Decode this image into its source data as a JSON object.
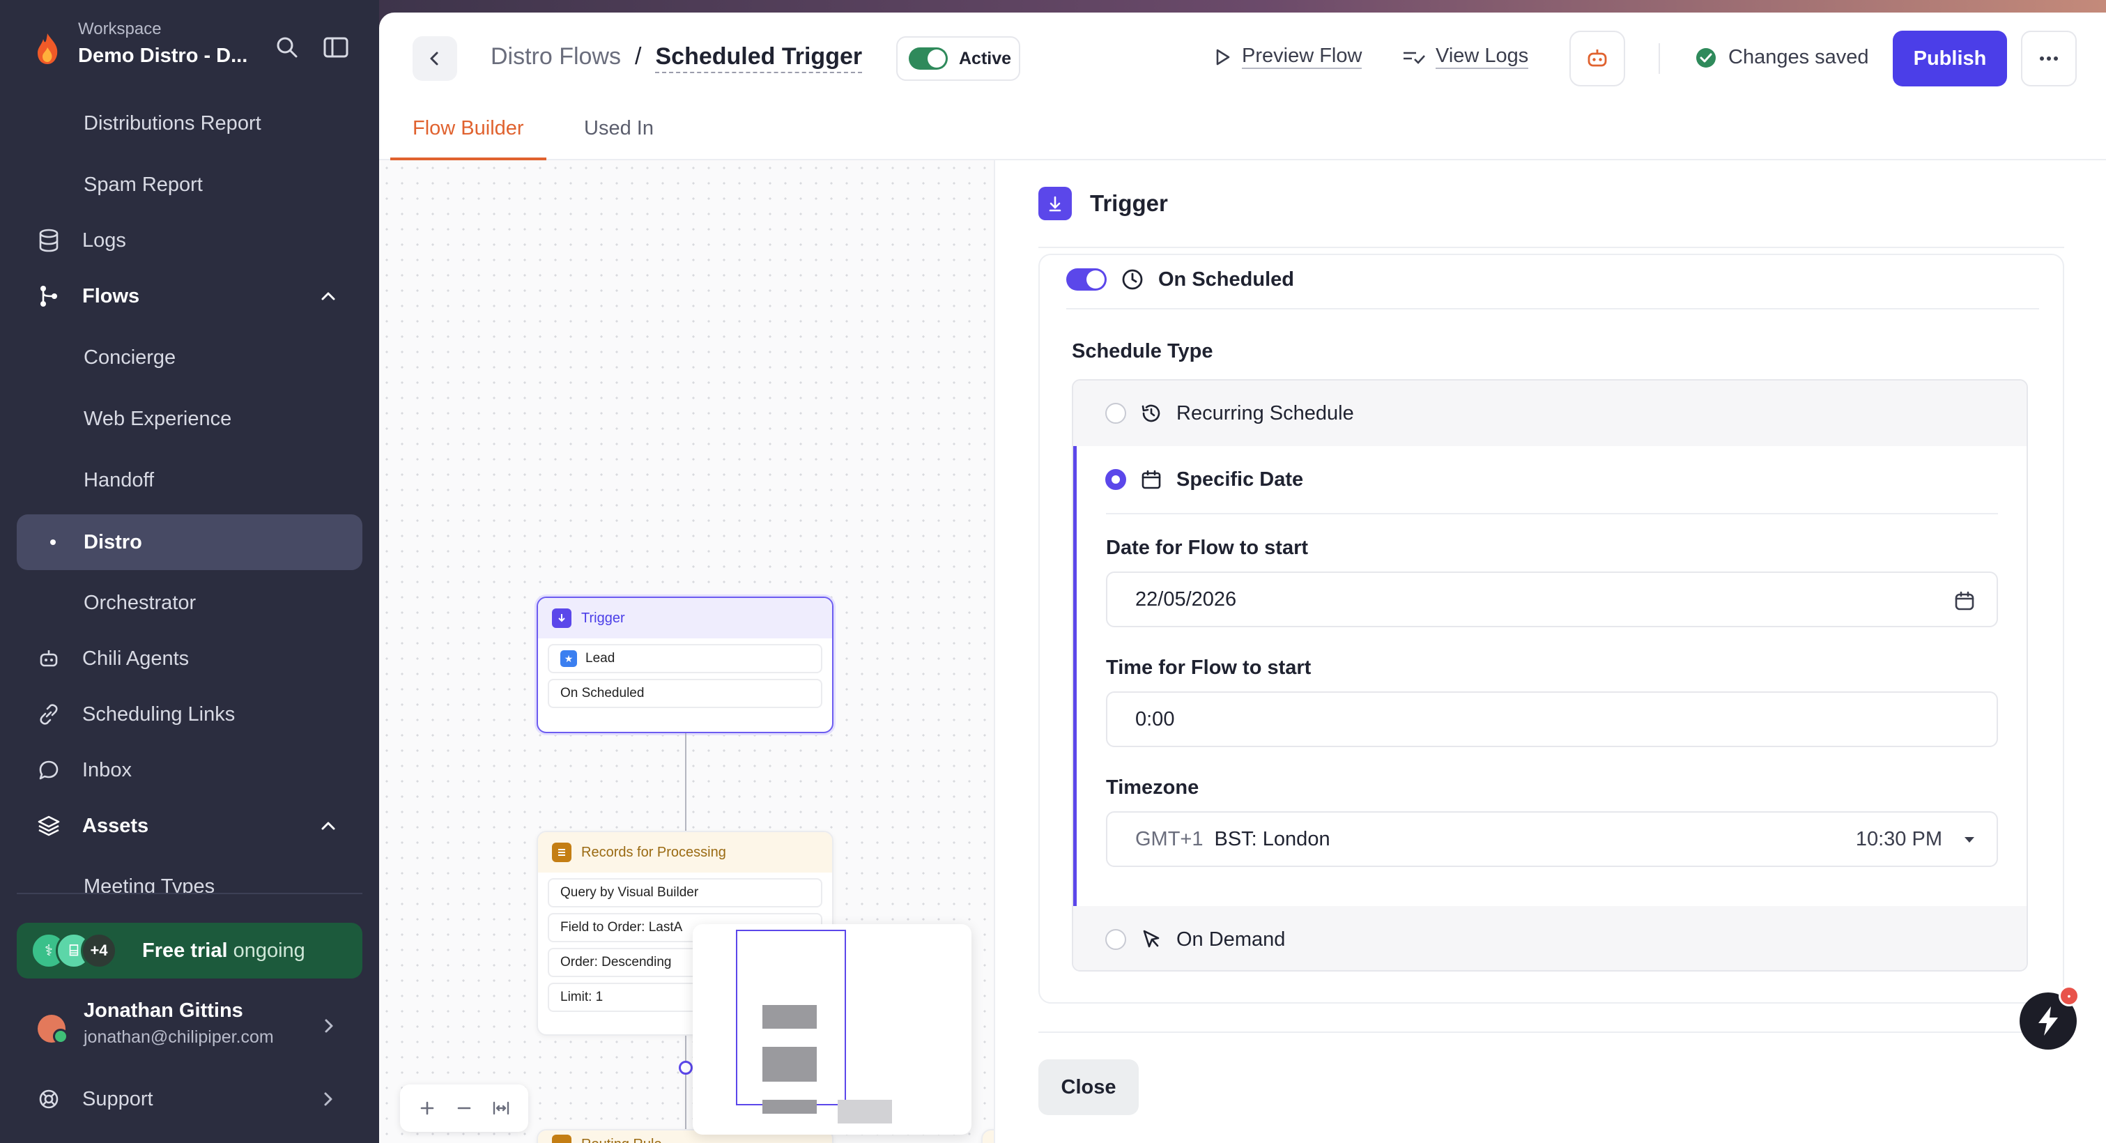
{
  "workspace": {
    "label": "Workspace",
    "name": "Demo Distro - D..."
  },
  "sidebar": {
    "items": [
      {
        "label": "Distributions Report"
      },
      {
        "label": "Spam Report"
      },
      {
        "label": "Logs",
        "icon": "database-icon"
      },
      {
        "label": "Flows",
        "icon": "flows-icon",
        "expanded": true
      },
      {
        "label": "Concierge"
      },
      {
        "label": "Web Experience"
      },
      {
        "label": "Handoff"
      },
      {
        "label": "Distro",
        "active": true
      },
      {
        "label": "Orchestrator"
      },
      {
        "label": "Chili Agents",
        "icon": "robot-icon"
      },
      {
        "label": "Scheduling Links",
        "icon": "link-icon"
      },
      {
        "label": "Inbox",
        "icon": "chat-icon"
      },
      {
        "label": "Assets",
        "icon": "layers-icon",
        "expanded": true
      },
      {
        "label": "Meeting Types"
      }
    ],
    "trial": {
      "extra_count": "+4",
      "title": "Free trial",
      "status": "ongoing"
    },
    "user": {
      "name": "Jonathan Gittins",
      "email": "jonathan@chilipiper.com"
    },
    "support": "Support"
  },
  "header": {
    "breadcrumb_parent": "Distro Flows",
    "breadcrumb_sep": "/",
    "breadcrumb_current": "Scheduled Trigger",
    "status": "Active",
    "preview": "Preview Flow",
    "logs": "View Logs",
    "saved": "Changes saved",
    "publish": "Publish"
  },
  "tabs": [
    {
      "label": "Flow Builder",
      "active": true
    },
    {
      "label": "Used In",
      "active": false
    }
  ],
  "canvas": {
    "trigger_node": {
      "title": "Trigger",
      "rows": [
        "Lead",
        "On Scheduled"
      ]
    },
    "records_node": {
      "title": "Records for Processing",
      "rows": [
        "Query by Visual Builder",
        "Field to Order: LastA",
        "Order: Descending",
        "Limit: 1"
      ]
    },
    "routing_node": {
      "title": "Routing Rule"
    }
  },
  "panel": {
    "title": "Trigger",
    "event": "On Scheduled",
    "schedule_type_label": "Schedule Type",
    "options": [
      {
        "label": "Recurring Schedule",
        "selected": false
      },
      {
        "label": "Specific Date",
        "selected": true
      },
      {
        "label": "On Demand",
        "selected": false
      }
    ],
    "date_label": "Date for Flow to start",
    "date_value": "22/05/2026",
    "time_label": "Time for Flow to start",
    "time_value": "0:00",
    "timezone_label": "Timezone",
    "timezone_offset": "GMT+1",
    "timezone_name": "BST: London",
    "timezone_time": "10:30 PM",
    "close": "Close"
  },
  "colors": {
    "accent": "#5b47ea",
    "tab_active": "#e0622f",
    "sidebar_bg": "#2b2d3f",
    "status_green": "#2f8a5b"
  }
}
